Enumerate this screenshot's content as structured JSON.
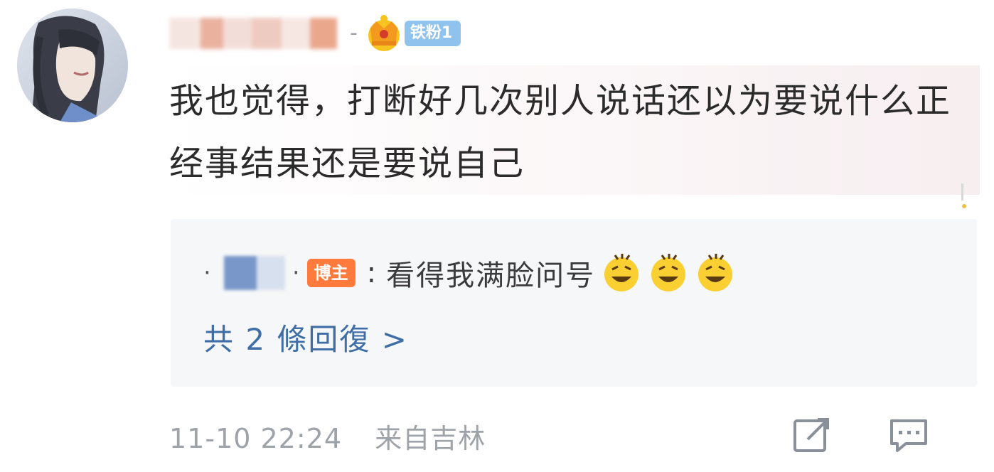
{
  "header": {
    "username_redacted": "",
    "separator": "-",
    "fan_badge": "铁粉1"
  },
  "comment": {
    "text": "我也觉得，打断好几次别人说话还以为要说什么正经事结果还是要说自己"
  },
  "reply": {
    "bullet": "·",
    "username_redacted": "",
    "separator_dot": "·",
    "blogger_badge": "博主",
    "colon": ":",
    "text": "看得我满脸问号",
    "emojis": [
      "grin-emoji",
      "grin-emoji",
      "grin-emoji"
    ],
    "more_label": "共 2 條回復 >"
  },
  "meta": {
    "timestamp": "11-10 22:24",
    "location": "来自吉林"
  },
  "colors": {
    "text": "#2b2b2b",
    "link": "#3f6ea6",
    "meta": "#9ea3aa",
    "fan_badge": "#8fc3ee",
    "blogger_badge": "#ff7a3d",
    "reply_bg": "#f6f7f9"
  }
}
